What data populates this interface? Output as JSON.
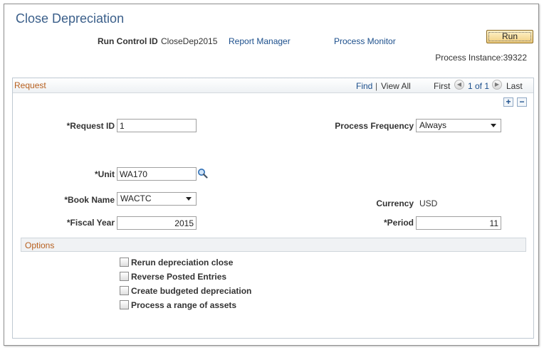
{
  "page": {
    "title": "Close Depreciation"
  },
  "run_control": {
    "label": "Run Control ID",
    "value": "CloseDep2015",
    "report_manager": "Report Manager",
    "process_monitor": "Process Monitor",
    "run_label": "Run",
    "process_instance": "Process Instance:39322"
  },
  "request": {
    "title": "Request",
    "find": "Find",
    "separator": "|",
    "view_all": "View All",
    "first": "First",
    "count": "1 of 1",
    "last": "Last",
    "add_label": "+",
    "delete_label": "−",
    "request_id": {
      "label": "*Request ID",
      "value": "1"
    },
    "process_frequency": {
      "label": "Process Frequency",
      "value": "Always"
    },
    "unit": {
      "label": "*Unit",
      "value": "WA170"
    },
    "book_name": {
      "label": "*Book Name",
      "value": "WACTC"
    },
    "currency": {
      "label": "Currency",
      "value": "USD"
    },
    "fiscal_year": {
      "label": "*Fiscal Year",
      "value": "2015"
    },
    "period": {
      "label": "*Period",
      "value": "11"
    }
  },
  "options": {
    "title": "Options",
    "items": [
      {
        "label": "Rerun depreciation close",
        "checked": false
      },
      {
        "label": "Reverse Posted Entries",
        "checked": false
      },
      {
        "label": "Create budgeted depreciation",
        "checked": false
      },
      {
        "label": "Process a range of assets",
        "checked": false
      }
    ]
  },
  "icons": {
    "lookup": "magnifier-icon",
    "first": "arrow-left-icon",
    "last": "arrow-right-icon"
  },
  "colors": {
    "title": "#3b5f8a",
    "link": "#1c4f8c",
    "section": "#b75f1e",
    "run_button": "#f1cf7f"
  }
}
